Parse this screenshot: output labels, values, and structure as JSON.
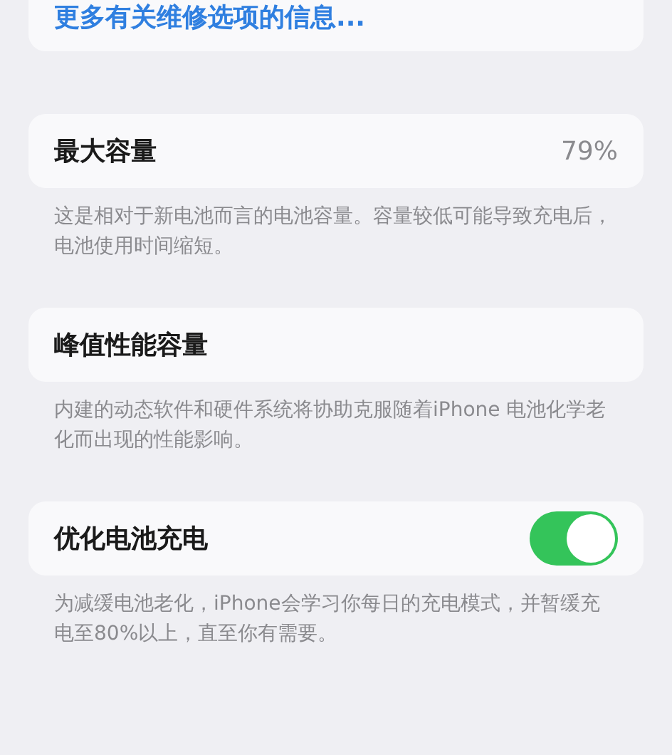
{
  "link_card": {
    "label": "更多有关维修选项的信息..."
  },
  "sections": [
    {
      "kind": "value",
      "title": "最大容量",
      "value": "79%",
      "footer": "这是相对于新电池而言的电池容量。容量较低可能导致充电后，电池使用时间缩短。"
    },
    {
      "kind": "plain",
      "title": "峰值性能容量",
      "footer": "内建的动态软件和硬件系统将协助克服随着iPhone 电池化学老化而出现的性能影响。"
    },
    {
      "kind": "toggle",
      "title": "优化电池充电",
      "on": true,
      "footer": "为减缓电池老化，iPhone会学习你每日的充电模式，并暂缓充电至80%以上，直至你有需要。"
    }
  ]
}
